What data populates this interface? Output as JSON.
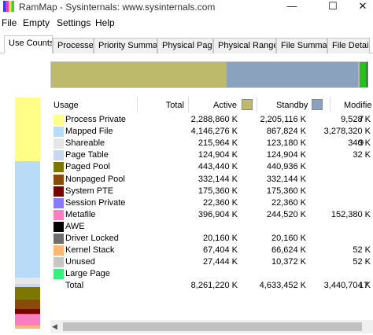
{
  "window": {
    "title": "RamMap - Sysinternals: www.sysinternals.com",
    "minimize_glyph": "—",
    "maximize_glyph": "☐",
    "close_glyph": "✕"
  },
  "menu": [
    "File",
    "Empty",
    "Settings",
    "Help"
  ],
  "tabs": [
    "Use Counts",
    "Processes",
    "Priority Summary",
    "Physical Pages",
    "Physical Ranges",
    "File Summary",
    "File Details"
  ],
  "active_tab": "Use Counts",
  "columns": {
    "usage": "Usage",
    "total": "Total",
    "active": "Active",
    "standby": "Standby",
    "modified": "Modifie"
  },
  "legend_colors": {
    "active": "#bdbb6b",
    "standby": "#8aa2be"
  },
  "rows": [
    {
      "name": "Process Private",
      "color": "#ffff88",
      "total": "2,288,860 K",
      "active": "2,205,116 K",
      "standby": "9,528 K",
      "modified": "7"
    },
    {
      "name": "Mapped File",
      "color": "#b8dcf8",
      "total": "4,146,276 K",
      "active": "867,824 K",
      "standby": "3,278,320 K",
      "modified": ""
    },
    {
      "name": "Shareable",
      "color": "#e6e6e6",
      "total": "215,964 K",
      "active": "123,180 K",
      "standby": "340 K",
      "modified": "9"
    },
    {
      "name": "Page Table",
      "color": "#c8d8f0",
      "total": "124,904 K",
      "active": "124,904 K",
      "standby": "32 K",
      "modified": ""
    },
    {
      "name": "Paged Pool",
      "color": "#7d7600",
      "total": "443,440 K",
      "active": "440,936 K",
      "standby": "",
      "modified": ""
    },
    {
      "name": "Nonpaged Pool",
      "color": "#8b4a0a",
      "total": "332,144 K",
      "active": "332,144 K",
      "standby": "",
      "modified": ""
    },
    {
      "name": "System PTE",
      "color": "#7a0000",
      "total": "175,360 K",
      "active": "175,360 K",
      "standby": "",
      "modified": ""
    },
    {
      "name": "Session Private",
      "color": "#8c78ff",
      "total": "22,360 K",
      "active": "22,360 K",
      "standby": "",
      "modified": ""
    },
    {
      "name": "Metafile",
      "color": "#f77fc1",
      "total": "396,904 K",
      "active": "244,520 K",
      "standby": "152,380 K",
      "modified": ""
    },
    {
      "name": "AWE",
      "color": "#000000",
      "total": "",
      "active": "",
      "standby": "",
      "modified": ""
    },
    {
      "name": "Driver Locked",
      "color": "#6e6e6e",
      "total": "20,160 K",
      "active": "20,160 K",
      "standby": "",
      "modified": ""
    },
    {
      "name": "Kernel Stack",
      "color": "#ffb874",
      "total": "67,404 K",
      "active": "66,624 K",
      "standby": "52 K",
      "modified": ""
    },
    {
      "name": "Unused",
      "color": "#c6c6c6",
      "total": "27,444 K",
      "active": "10,372 K",
      "standby": "52 K",
      "modified": ""
    },
    {
      "name": "Large Page",
      "color": "#38ef7d",
      "total": "",
      "active": "",
      "standby": "",
      "modified": ""
    },
    {
      "name": "Total",
      "color": "",
      "total": "8,261,220 K",
      "active": "4,633,452 K",
      "standby": "3,440,704 K",
      "modified": "17"
    }
  ],
  "usage_bar": {
    "segments": [
      {
        "fraction": 0.555,
        "color": "#bdbb6b"
      },
      {
        "fraction": 0.415,
        "color": "#8aa2be"
      },
      {
        "fraction": 0.005,
        "color": "#d3a8a8"
      },
      {
        "fraction": 0.022,
        "color": "#22c41c"
      },
      {
        "fraction": 0.003,
        "color": "#111111"
      }
    ]
  },
  "vertical_bar": {
    "segments": [
      {
        "fraction": 0.277,
        "color": "#ffff88"
      },
      {
        "fraction": 0.502,
        "color": "#b8dcf8"
      },
      {
        "fraction": 0.026,
        "color": "#e6e6e6"
      },
      {
        "fraction": 0.015,
        "color": "#c8d8f0"
      },
      {
        "fraction": 0.054,
        "color": "#7d7600"
      },
      {
        "fraction": 0.04,
        "color": "#8b4a0a"
      },
      {
        "fraction": 0.021,
        "color": "#7a0000"
      },
      {
        "fraction": 0.003,
        "color": "#8c78ff"
      },
      {
        "fraction": 0.048,
        "color": "#f77fc1"
      },
      {
        "fraction": 0.014,
        "color": "#ffb874"
      }
    ]
  }
}
